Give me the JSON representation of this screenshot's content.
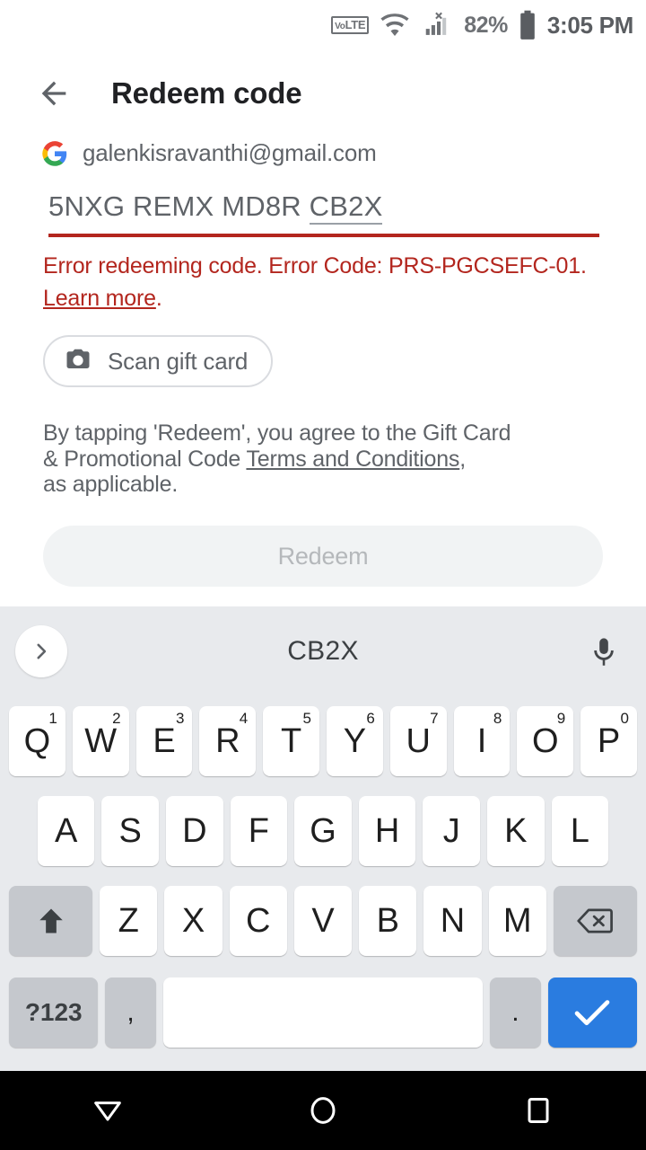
{
  "status_bar": {
    "volte_label": "VoLTE",
    "volte_prefix": "Vo",
    "volte_suffix": "LTE",
    "wifi_icon": "wifi-icon",
    "signal_icon": "cellular-signal-no-service-icon",
    "battery_percent": "82%",
    "battery_icon": "battery-icon",
    "time": "3:05 PM"
  },
  "app_bar": {
    "back_icon": "back-arrow-icon",
    "title": "Redeem code"
  },
  "account": {
    "logo": "google-g-icon",
    "email": "galenkisravanthi@gmail.com"
  },
  "code_field": {
    "value_plain": "5NXG REMX MD8R ",
    "value_spellchecked": "CB2X",
    "full_value": "5NXG REMX MD8R CB2X",
    "underline_color": "#b3261e"
  },
  "error": {
    "message": "Error redeeming code. Error Code: PRS-PGCSEFC-01.",
    "link": "Learn more",
    "trailing": ".",
    "color": "#b3261e"
  },
  "scan_button": {
    "icon": "camera-icon",
    "label": "Scan gift card"
  },
  "terms": {
    "line1": "By tapping 'Redeem', you agree to the Gift Card",
    "line2_prefix": "& Promotional Code ",
    "link": "Terms and Conditions",
    "line2_suffix": ",",
    "line3": "as applicable."
  },
  "redeem_button": {
    "label": "Redeem",
    "enabled": false,
    "background": "#f1f3f4",
    "text_color": "#b5b8bb"
  },
  "keyboard": {
    "suggestion": "CB2X",
    "expand_icon": "chevron-right-icon",
    "mic_icon": "microphone-icon",
    "row1": [
      {
        "key": "Q",
        "num": "1"
      },
      {
        "key": "W",
        "num": "2"
      },
      {
        "key": "E",
        "num": "3"
      },
      {
        "key": "R",
        "num": "4"
      },
      {
        "key": "T",
        "num": "5"
      },
      {
        "key": "Y",
        "num": "6"
      },
      {
        "key": "U",
        "num": "7"
      },
      {
        "key": "I",
        "num": "8"
      },
      {
        "key": "O",
        "num": "9"
      },
      {
        "key": "P",
        "num": "0"
      }
    ],
    "row2": [
      "A",
      "S",
      "D",
      "F",
      "G",
      "H",
      "J",
      "K",
      "L"
    ],
    "row3": [
      "Z",
      "X",
      "C",
      "V",
      "B",
      "N",
      "M"
    ],
    "shift_icon": "shift-up-arrow-icon",
    "backspace_icon": "backspace-icon",
    "symbols_key": "?123",
    "comma_key": ",",
    "space_key": "",
    "period_key": ".",
    "enter_icon": "checkmark-icon",
    "enter_color": "#2a7ce0"
  },
  "nav_bar": {
    "back_icon": "nav-back-triangle-icon",
    "home_icon": "nav-home-circle-icon",
    "recents_icon": "nav-recents-square-icon"
  }
}
